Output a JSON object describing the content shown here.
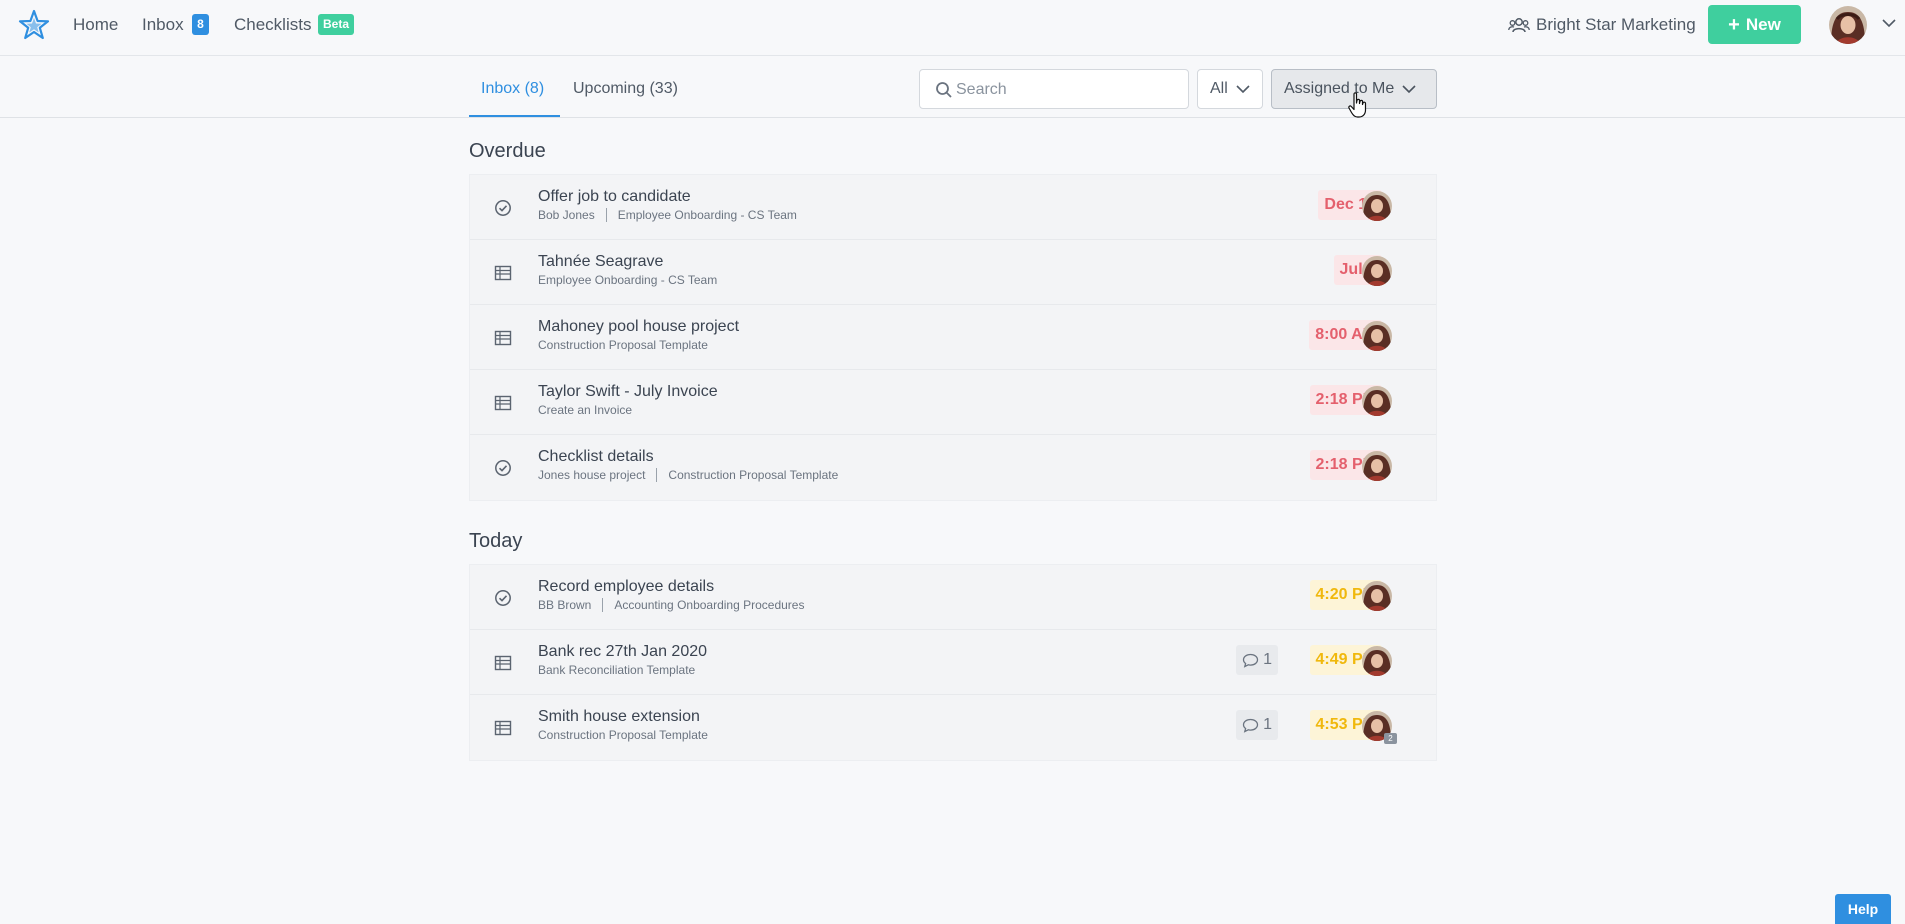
{
  "nav": {
    "home": "Home",
    "inbox": "Inbox",
    "inbox_count": "8",
    "checklists": "Checklists",
    "beta": "Beta",
    "org_name": "Bright Star Marketing",
    "new_label": "New"
  },
  "toolbar": {
    "tab_inbox": "Inbox (8)",
    "tab_upcoming": "Upcoming (33)",
    "search_placeholder": "Search",
    "filter_all": "All",
    "filter_assigned": "Assigned to Me"
  },
  "sections": {
    "overdue": {
      "title": "Overdue",
      "items": [
        {
          "icon": "check-circle-icon",
          "title": "Offer job to candidate",
          "sub": [
            "Bob Jones",
            "Employee Onboarding - CS Team"
          ],
          "due": "Dec 16"
        },
        {
          "icon": "table-icon",
          "title": "Tahnée Seagrave",
          "sub": [
            "Employee Onboarding - CS Team"
          ],
          "due": "Jul 6"
        },
        {
          "icon": "table-icon",
          "title": "Mahoney pool house project",
          "sub": [
            "Construction Proposal Template"
          ],
          "due": "8:00 AM"
        },
        {
          "icon": "table-icon",
          "title": "Taylor Swift - July Invoice",
          "sub": [
            "Create an Invoice"
          ],
          "due": "2:18 PM"
        },
        {
          "icon": "check-circle-icon",
          "title": "Checklist details",
          "sub": [
            "Jones house project",
            "Construction Proposal Template"
          ],
          "due": "2:18 PM"
        }
      ]
    },
    "today": {
      "title": "Today",
      "items": [
        {
          "icon": "check-circle-icon",
          "title": "Record employee details",
          "sub": [
            "BB Brown",
            "Accounting Onboarding Procedures"
          ],
          "due": "4:20 PM"
        },
        {
          "icon": "table-icon",
          "title": "Bank rec 27th Jan 2020",
          "sub": [
            "Bank Reconciliation Template"
          ],
          "due": "4:49 PM",
          "comments": "1"
        },
        {
          "icon": "table-icon",
          "title": "Smith house extension",
          "sub": [
            "Construction Proposal Template"
          ],
          "due": "4:53 PM",
          "comments": "1",
          "assignee_extra": "2"
        }
      ]
    }
  },
  "help_label": "Help",
  "colors": {
    "accent_blue": "#2f8fe0",
    "accent_green": "#3fcf9e",
    "overdue_red": "#e4606d",
    "today_yellow": "#f0b80d"
  }
}
